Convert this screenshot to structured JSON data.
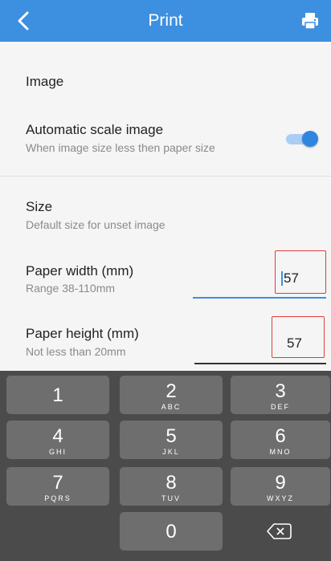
{
  "appbar": {
    "title": "Print",
    "back_icon": "chevron-left-icon",
    "action_icon": "printer-icon",
    "color": "#3d8fe0"
  },
  "sections": {
    "image": {
      "title": "Image",
      "auto_scale": {
        "label": "Automatic scale image",
        "description": "When image size less then paper size",
        "enabled": true
      }
    },
    "size": {
      "title": "Size",
      "description": "Default size for unset image",
      "paper_width": {
        "label": "Paper width (mm)",
        "hint": "Range 38-110mm",
        "value": "57"
      },
      "paper_height": {
        "label": "Paper height (mm)",
        "hint": "Not less than 20mm",
        "value": "57"
      }
    }
  },
  "keypad": {
    "keys": [
      {
        "num": "1",
        "letters": ""
      },
      {
        "num": "2",
        "letters": "ABC"
      },
      {
        "num": "3",
        "letters": "DEF"
      },
      {
        "num": "4",
        "letters": "GHI"
      },
      {
        "num": "5",
        "letters": "JKL"
      },
      {
        "num": "6",
        "letters": "MNO"
      },
      {
        "num": "7",
        "letters": "PQRS"
      },
      {
        "num": "8",
        "letters": "TUV"
      },
      {
        "num": "9",
        "letters": "WXYZ"
      },
      {
        "num": "0",
        "letters": ""
      }
    ],
    "backspace_icon": "backspace-icon"
  },
  "colors": {
    "accent": "#3d8fe0",
    "highlight": "#e23b3b",
    "keyboard_bg": "#4b4b4b",
    "key_bg": "#6e6e6e"
  }
}
